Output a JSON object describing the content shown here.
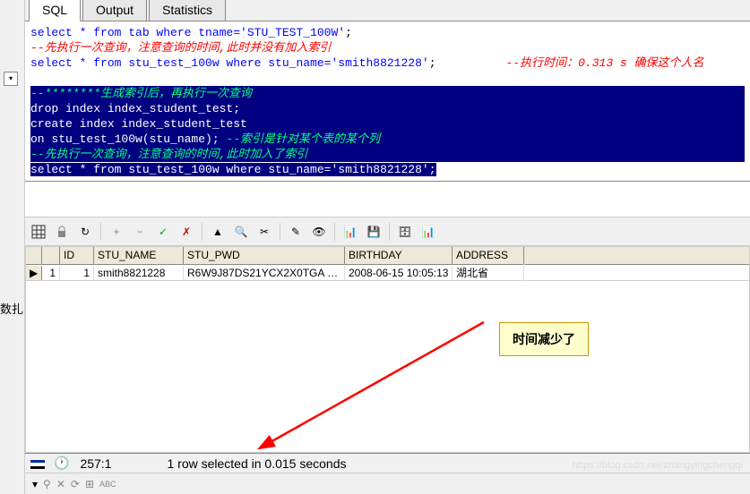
{
  "tabs": {
    "sql": "SQL",
    "output": "Output",
    "statistics": "Statistics"
  },
  "editor": {
    "line1_pre": "select * from tab where tname=",
    "line1_str": "'STU_TEST_100W'",
    "line1_end": ";",
    "line2": "--先执行一次查询，注意查询的时间,此时并没有加入索引",
    "line3_pre": "select  * from stu_test_100w where stu_name=",
    "line3_str": "'smith8821228'",
    "line3_end": ";",
    "line3_comment": "--执行时间：0.313 s    确保这个人名",
    "sel_line1": "--********生成索引后，再执行一次查询",
    "sel_line2": "drop index index_student_test;",
    "sel_blank": " ",
    "sel_line3": "create index index_student_test",
    "sel_line4_pre": "on stu_test_100w(stu_name);",
    "sel_line4_comment": "     --索引是针对某个表的某个列",
    "sel_line5": "--先执行一次查询，注意查询的时间,此时加入了索引",
    "sel_line6_pre": "select *  from stu_test_100w where stu_name=",
    "sel_line6_str": "'smith8821228'",
    "sel_line6_end": ";"
  },
  "grid": {
    "headers": {
      "rownum": "",
      "id": "ID",
      "stu_name": "STU_NAME",
      "stu_pwd": "STU_PWD",
      "birthday": "BIRTHDAY",
      "address": "ADDRESS"
    },
    "row": {
      "indicator": "▶",
      "num": "1",
      "id": "1",
      "stu_name": "smith8821228",
      "stu_pwd": "R6W9J87DS21YCX2X0TGA",
      "stu_pwd_ellipsis": "…",
      "birthday": "2008-06-15 10:05:13",
      "address": "湖北省"
    }
  },
  "callout": "时间减少了",
  "status": {
    "position": "257:1",
    "message": "1 row selected in 0.015 seconds"
  },
  "side_label": "数扎",
  "watermark": "https://blog.csdn.net/zhangyingchengqi"
}
